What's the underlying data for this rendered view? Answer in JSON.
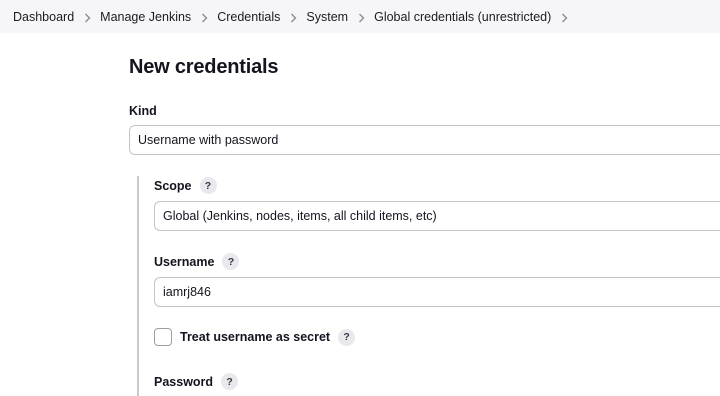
{
  "breadcrumb": {
    "items": [
      "Dashboard",
      "Manage Jenkins",
      "Credentials",
      "System",
      "Global credentials (unrestricted)"
    ]
  },
  "page": {
    "title": "New credentials"
  },
  "kind": {
    "label": "Kind",
    "value": "Username with password"
  },
  "scope": {
    "label": "Scope",
    "help": "?",
    "value": "Global (Jenkins, nodes, items, all child items, etc)"
  },
  "username": {
    "label": "Username",
    "help": "?",
    "value": "iamrj846"
  },
  "secret_checkbox": {
    "label": "Treat username as secret",
    "help": "?",
    "checked": false
  },
  "password": {
    "label": "Password",
    "help": "?"
  }
}
